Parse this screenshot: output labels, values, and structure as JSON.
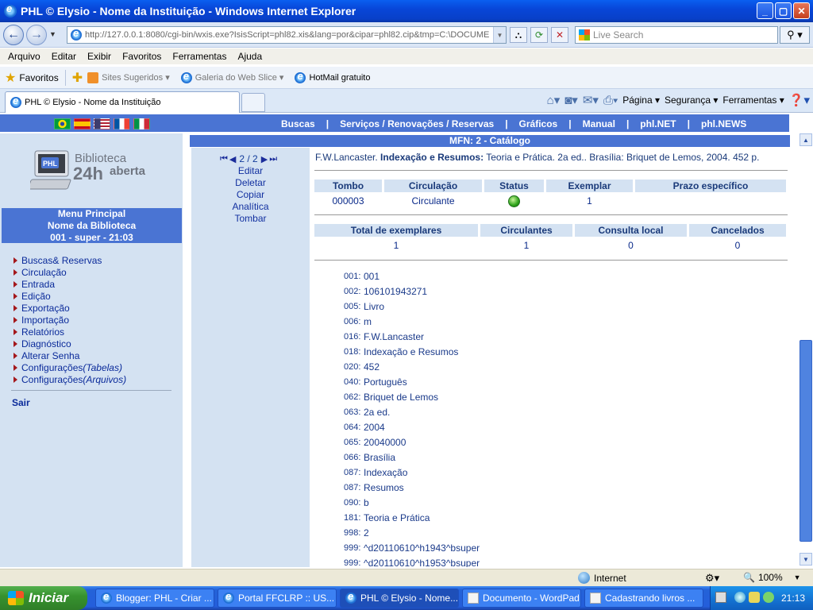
{
  "window": {
    "title": "PHL © Elysio - Nome da Instituição - Windows Internet Explorer",
    "btn_min": "_",
    "btn_max": "▢",
    "btn_close": "✕"
  },
  "address": {
    "url": "http://127.0.0.1:8080/cgi-bin/wxis.exe?IsisScript=phl82.xis&lang=por&cipar=phl82.cip&tmp=C:\\DOCUME",
    "search_placeholder": "Live Search"
  },
  "menubar": [
    "Arquivo",
    "Editar",
    "Exibir",
    "Favoritos",
    "Ferramentas",
    "Ajuda"
  ],
  "favbar": {
    "label": "Favoritos",
    "items": [
      "Sites Sugeridos ▾",
      "Galeria do Web Slice ▾",
      "HotMail gratuito"
    ]
  },
  "tabs": {
    "active": "PHL © Elysio - Nome da Instituição"
  },
  "cmdbar": {
    "page": "Página ▾",
    "safety": "Segurança ▾",
    "tools": "Ferramentas ▾"
  },
  "site": {
    "nav": [
      "Buscas",
      "Serviços / Renovações / Reservas",
      "Gráficos",
      "Manual",
      "phl.NET",
      "phl.NEWS"
    ],
    "nav_sep": "|",
    "logo": {
      "line1": "Biblioteca",
      "line2": "24h",
      "line3": "aberta",
      "badge": "PHL"
    },
    "menu_head": [
      "Menu Principal",
      "Nome da Biblioteca",
      "001 - super - 21:03"
    ],
    "menu_items": [
      {
        "label": "Buscas& Reservas",
        "italic": ""
      },
      {
        "label": "Circulação",
        "italic": ""
      },
      {
        "label": "Entrada",
        "italic": ""
      },
      {
        "label": "Edição",
        "italic": ""
      },
      {
        "label": "Exportação",
        "italic": ""
      },
      {
        "label": "Importação",
        "italic": ""
      },
      {
        "label": "Relatórios",
        "italic": ""
      },
      {
        "label": "Diagnóstico",
        "italic": ""
      },
      {
        "label": "Alterar Senha",
        "italic": ""
      },
      {
        "label": "Configurações",
        "italic": "(Tabelas)"
      },
      {
        "label": "Configurações",
        "italic": "(Arquivos)"
      }
    ],
    "logout": "Sair",
    "mfn_bar": "MFN: 2 - Catálogo",
    "rec_nav": {
      "position": "2 / 2"
    },
    "rec_actions": [
      "Editar",
      "Deletar",
      "Copiar",
      "Analítica",
      "Tombar"
    ],
    "citation": {
      "author": "F.W.Lancaster. ",
      "title": "Indexação e Resumos:",
      "rest": " Teoria e Prática. 2a ed.. Brasília: Briquet de Lemos, 2004. 452 p."
    },
    "copies_headers": [
      "Tombo",
      "Circulação",
      "Status",
      "Exemplar",
      "Prazo específico"
    ],
    "copies_row": [
      "000003",
      "Circulante",
      "",
      "1",
      ""
    ],
    "totals_headers": [
      "Total de exemplares",
      "Circulantes",
      "Consulta local",
      "Cancelados"
    ],
    "totals_row": [
      "1",
      "1",
      "0",
      "0"
    ],
    "fields": [
      {
        "tag": "001:",
        "value": "001"
      },
      {
        "tag": "002:",
        "value": "106101943271"
      },
      {
        "tag": "005:",
        "value": "Livro"
      },
      {
        "tag": "006:",
        "value": "m"
      },
      {
        "tag": "016:",
        "value": "F.W.Lancaster"
      },
      {
        "tag": "018:",
        "value": "Indexação e Resumos"
      },
      {
        "tag": "020:",
        "value": "452"
      },
      {
        "tag": "040:",
        "value": "Português"
      },
      {
        "tag": "062:",
        "value": "Briquet de Lemos"
      },
      {
        "tag": "063:",
        "value": "2a ed."
      },
      {
        "tag": "064:",
        "value": "2004"
      },
      {
        "tag": "065:",
        "value": "20040000"
      },
      {
        "tag": "066:",
        "value": "Brasília"
      },
      {
        "tag": "087:",
        "value": "Indexação"
      },
      {
        "tag": "087:",
        "value": "Resumos"
      },
      {
        "tag": "090:",
        "value": "b"
      },
      {
        "tag": "181:",
        "value": "Teoria e Prática"
      },
      {
        "tag": "998:",
        "value": "2"
      },
      {
        "tag": "999:",
        "value": "^d20110610^h1943^bsuper"
      },
      {
        "tag": "999:",
        "value": "^d20110610^h1953^bsuper"
      }
    ]
  },
  "status": {
    "zone": "Internet",
    "zoom": "100%"
  },
  "taskbar": {
    "start": "Iniciar",
    "items": [
      "Blogger: PHL - Criar ...",
      "Portal FFCLRP :: US...",
      "PHL © Elysio - Nome...",
      "Documento - WordPad",
      "Cadastrando livros ..."
    ],
    "clock": "21:13"
  },
  "colors": {
    "accent": "#4a74d3",
    "panel": "#d4e2f2",
    "link": "#0a2a9a",
    "status_available": "#2ea31b"
  }
}
